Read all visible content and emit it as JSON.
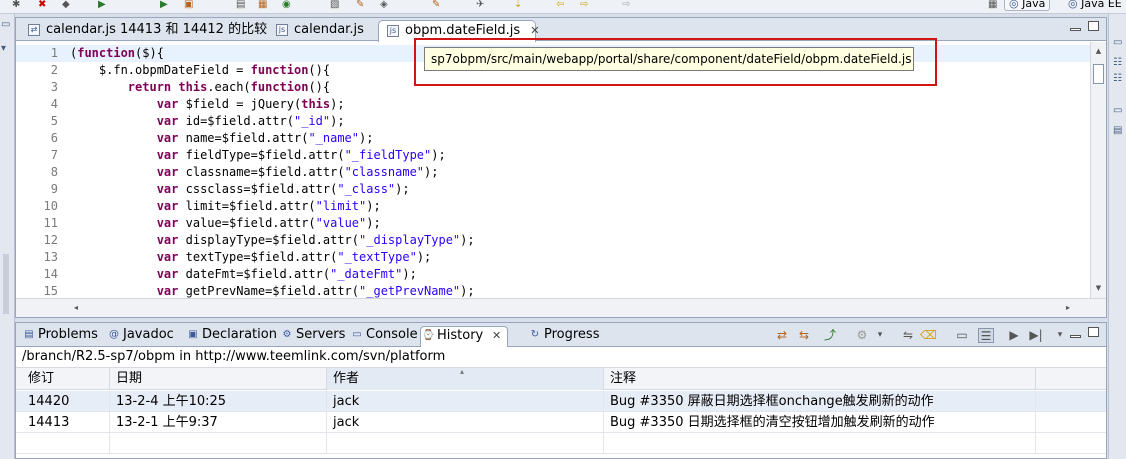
{
  "perspectives": {
    "java": "Java",
    "java_ee": "Java EE"
  },
  "editor": {
    "tabs": [
      {
        "label": "calendar.js 14413 和 14412 的比较",
        "icon": "compare-icon"
      },
      {
        "label": "calendar.js",
        "icon": "js-file-icon"
      },
      {
        "label": "obpm.dateField.js",
        "icon": "js-file-icon",
        "close": "✕"
      }
    ],
    "tooltip": "sp7obpm/src/main/webapp/portal/share/component/dateField/obpm.dateField.js",
    "lines": [
      {
        "n": "1",
        "code": "(function($){"
      },
      {
        "n": "2",
        "code": "    $.fn.obpmDateField = function(){"
      },
      {
        "n": "3",
        "code": "        return this.each(function(){"
      },
      {
        "n": "4",
        "code": "            var $field = jQuery(this);"
      },
      {
        "n": "5",
        "code": "            var id=$field.attr(\"_id\");"
      },
      {
        "n": "6",
        "code": "            var name=$field.attr(\"_name\");"
      },
      {
        "n": "7",
        "code": "            var fieldType=$field.attr(\"_fieldType\");"
      },
      {
        "n": "8",
        "code": "            var classname=$field.attr(\"classname\");"
      },
      {
        "n": "9",
        "code": "            var cssclass=$field.attr(\"_class\");"
      },
      {
        "n": "10",
        "code": "            var limit=$field.attr(\"limit\");"
      },
      {
        "n": "11",
        "code": "            var value=$field.attr(\"value\");"
      },
      {
        "n": "12",
        "code": "            var displayType=$field.attr(\"_displayType\");"
      },
      {
        "n": "13",
        "code": "            var textType=$field.attr(\"_textType\");"
      },
      {
        "n": "14",
        "code": "            var dateFmt=$field.attr(\"_dateFmt\");"
      },
      {
        "n": "15",
        "code": "            var getPrevName=$field.attr(\"_getPrevName\");"
      }
    ]
  },
  "panel": {
    "tabs": [
      {
        "label": "Problems",
        "icon": "problems-icon"
      },
      {
        "label": "Javadoc",
        "icon": "javadoc-icon"
      },
      {
        "label": "Declaration",
        "icon": "declaration-icon"
      },
      {
        "label": "Servers",
        "icon": "servers-icon"
      },
      {
        "label": "Console",
        "icon": "console-icon"
      },
      {
        "label": "History",
        "icon": "history-icon",
        "close": "✕"
      },
      {
        "label": "Progress",
        "icon": "progress-icon"
      }
    ],
    "path": "/branch/R2.5-sp7/obpm in http://www.teemlink.com/svn/platform",
    "columns": [
      "修订",
      "日期",
      "作者",
      "注释"
    ],
    "rows": [
      {
        "rev": "14420",
        "date": "13-2-4 上午10:25",
        "author": "jack",
        "comment": "Bug #3350 屏蔽日期选择框onchange触发刷新的动作"
      },
      {
        "rev": "14413",
        "date": "13-2-1 上午9:37",
        "author": "jack",
        "comment": "Bug #3350 日期选择框的清空按钮增加触发刷新的动作"
      }
    ]
  }
}
